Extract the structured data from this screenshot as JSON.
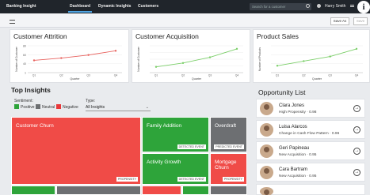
{
  "app": {
    "brand": "Banking Insight"
  },
  "nav": [
    {
      "label": "Dashboard",
      "active": true
    },
    {
      "label": "Dynamic Insights",
      "active": false
    },
    {
      "label": "Customers",
      "active": false
    }
  ],
  "search": {
    "placeholder": "Search for a customer"
  },
  "user": {
    "name": "Harry Smith"
  },
  "toolbar": {
    "save_as": "Save As",
    "save": "Save"
  },
  "charts": [
    {
      "title": "Customer Attrition",
      "ylabel": "Number of Customer",
      "xlabel": "Quarter",
      "ticks": [
        "1",
        "40",
        "60",
        "80"
      ],
      "xticks": [
        "Q1",
        "Q2",
        "Q3",
        "Q4"
      ],
      "color": "#e8625e"
    },
    {
      "title": "Customer Acquisition",
      "ylabel": "Number of Customer",
      "xlabel": "Quarter",
      "ticks": [
        "",
        "",
        "",
        "",
        ""
      ],
      "xticks": [
        "Q1",
        "Q2",
        "Q3",
        "Q4"
      ],
      "color": "#7ccf6a"
    },
    {
      "title": "Product Sales",
      "ylabel": "Number of Products",
      "xlabel": "Quarter",
      "ticks": [
        "",
        "",
        "",
        ""
      ],
      "xticks": [
        "Q1",
        "Q2",
        "Q3",
        "Q4"
      ],
      "color": "#7ccf6a"
    }
  ],
  "chart_data": [
    {
      "type": "line",
      "title": "Customer Attrition",
      "xlabel": "Quarter",
      "ylabel": "Number of Customer",
      "x": [
        "Q1",
        "Q2",
        "Q3",
        "Q4"
      ],
      "values": [
        52,
        58,
        66,
        77
      ],
      "ylim": [
        20,
        90
      ]
    },
    {
      "type": "line",
      "title": "Customer Acquisition",
      "xlabel": "Quarter",
      "ylabel": "Number of Customer",
      "x": [
        "Q1",
        "Q2",
        "Q3",
        "Q4"
      ],
      "values": [
        35,
        45,
        60,
        82
      ],
      "ylim": [
        20,
        90
      ]
    },
    {
      "type": "line",
      "title": "Product Sales",
      "xlabel": "Quarter",
      "ylabel": "Number of Products",
      "x": [
        "Q1",
        "Q2",
        "Q3",
        "Q4"
      ],
      "values": [
        38,
        50,
        62,
        82
      ],
      "ylim": [
        20,
        90
      ]
    }
  ],
  "insights": {
    "title": "Top Insights",
    "sentiment_label": "Sentiment:",
    "type_label": "Type:",
    "type_value": "All Insights",
    "legend": [
      {
        "label": "Positive",
        "color": "#2ea43a"
      },
      {
        "label": "Neutral",
        "color": "#6d6f72"
      },
      {
        "label": "Negative",
        "color": "#e8393b"
      }
    ],
    "tiles": [
      {
        "label": "Customer Churn",
        "tag": "PROPENSITY",
        "color": "#f04b47"
      },
      {
        "label": "Family Addition",
        "tag": "DETECTED EVENT",
        "color": "#2ea43a"
      },
      {
        "label": "Overdraft",
        "tag": "PREDICTED EVENT",
        "color": "#6d6f72"
      },
      {
        "label": "Activity Growth",
        "tag": "DETECTED EVENT",
        "color": "#2ea43a"
      },
      {
        "label": "Mortgage Churn",
        "tag": "PROPENSITY",
        "color": "#f04b47"
      },
      {
        "label": "",
        "tag": "",
        "color": "#2ea43a"
      },
      {
        "label": "",
        "tag": "",
        "color": "#6d6f72"
      },
      {
        "label": "",
        "tag": "",
        "color": "#f04b47"
      },
      {
        "label": "",
        "tag": "",
        "color": "#2ea43a"
      },
      {
        "label": "",
        "tag": "",
        "color": "#6d6f72"
      }
    ]
  },
  "opportunities": {
    "title": "Opportunity List",
    "items": [
      {
        "name": "Clara Jones",
        "desc": "High Propensity · 0.98"
      },
      {
        "name": "Luisa Alarcos",
        "desc": "Change in Cash Flow Pattern · 0.96"
      },
      {
        "name": "Geri Papineau",
        "desc": "New Acquisition · 0.95"
      },
      {
        "name": "Cara Bartram",
        "desc": "New Acquisition · 0.95"
      },
      {
        "name": "",
        "desc": ""
      }
    ]
  }
}
